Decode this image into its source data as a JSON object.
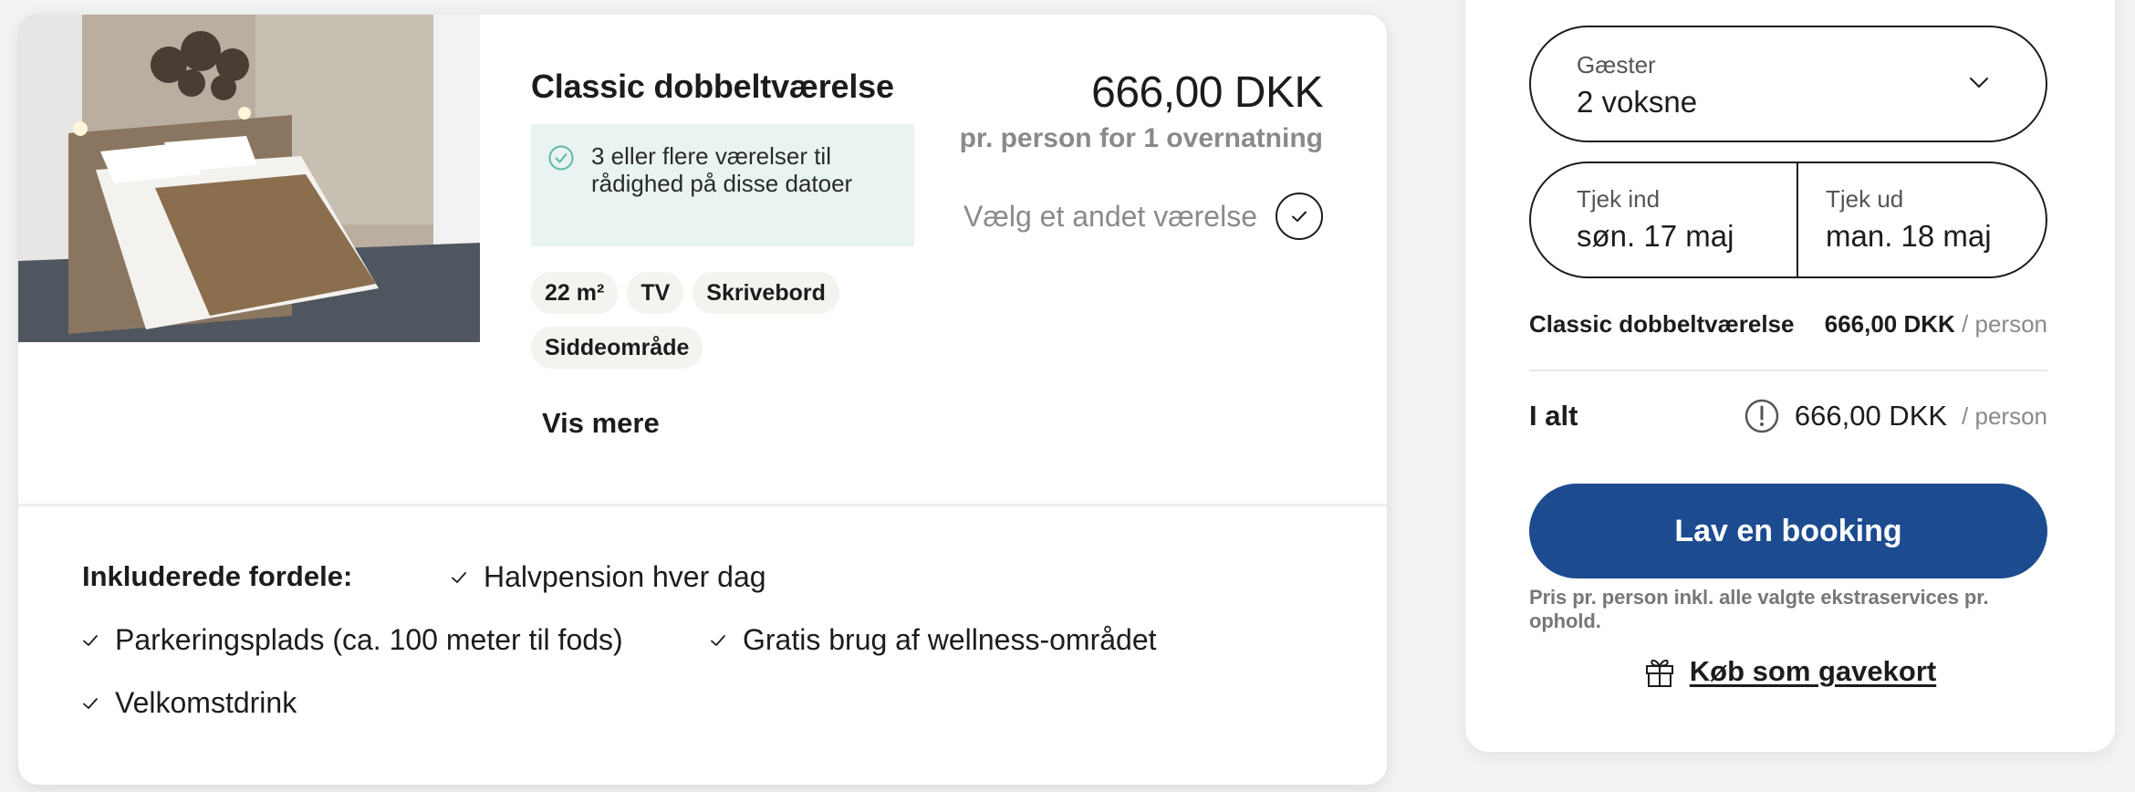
{
  "room": {
    "title": "Classic dobbeltværelse",
    "availability": "3 eller flere værelser til rådighed på disse datoer",
    "tags": [
      "22 m²",
      "TV",
      "Skrivebord",
      "Siddeområde"
    ],
    "show_more": "Vis mere",
    "price": "666,00 DKK",
    "price_sub": "pr. person for 1 overnatning",
    "choose_room": "Vælg et andet værelse"
  },
  "benefits": {
    "label": "Inkluderede fordele:",
    "items": [
      "Halvpension hver dag",
      "Parkeringsplads (ca. 100 meter til fods)",
      "Gratis brug af wellness-området",
      "Velkomstdrink"
    ]
  },
  "booking": {
    "guests_label": "Gæster",
    "guests_value": "2 voksne",
    "checkin_label": "Tjek ind",
    "checkin_value": "søn. 17 maj",
    "checkout_label": "Tjek ud",
    "checkout_value": "man. 18 maj",
    "room_line_label": "Classic dobbeltværelse",
    "room_line_price": "666,00 DKK",
    "per_person": "/ person",
    "total_label": "I alt",
    "total_price": "666,00 DKK",
    "book_button": "Lav en booking",
    "note": "Pris pr. person inkl. alle valgte ekstraservices pr. ophold.",
    "gift_link": "Køb som gavekort"
  },
  "colors": {
    "primary": "#1c4b90",
    "availability_bg": "#e9f4f2",
    "availability_icon": "#5fb8a6",
    "muted": "#8a8a8a"
  },
  "icons": {
    "availability": "check-circle-icon",
    "choose_room": "check-icon",
    "guests": "chevron-down-icon",
    "total": "info-exclamation-icon",
    "gift": "gift-icon"
  }
}
